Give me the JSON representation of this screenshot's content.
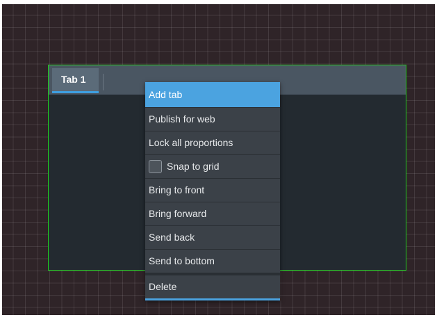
{
  "tab_widget": {
    "tabs": [
      {
        "label": "Tab 1",
        "selected": true
      }
    ],
    "accent_color": "#3f9fe0",
    "selection_border_color": "#1fd11f"
  },
  "context_menu": {
    "items": [
      {
        "label": "Add tab",
        "highlighted": true
      },
      {
        "label": "Publish for web"
      },
      {
        "label": "Lock all proportions"
      },
      {
        "label": "Snap to grid",
        "has_checkbox": true,
        "checked": false
      },
      {
        "label": "Bring to front"
      },
      {
        "label": "Bring forward"
      },
      {
        "label": "Send back"
      },
      {
        "label": "Send to bottom"
      },
      {
        "label": "Delete"
      }
    ],
    "highlight_color": "#4ba3e0"
  }
}
